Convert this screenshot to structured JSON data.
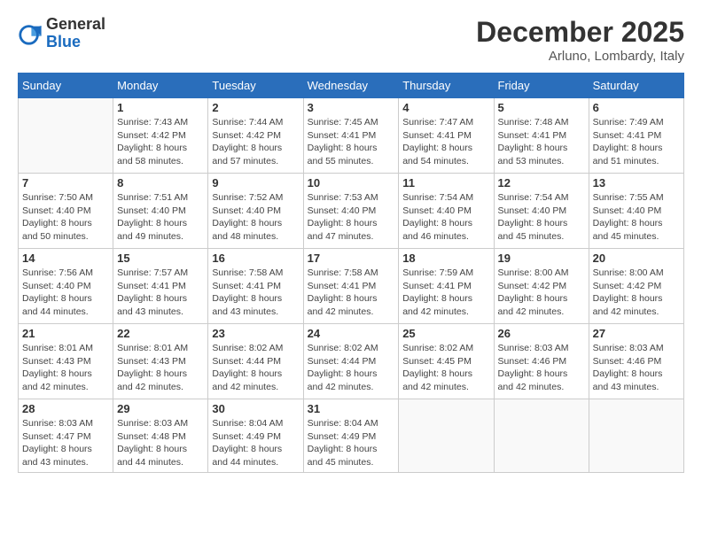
{
  "logo": {
    "general": "General",
    "blue": "Blue"
  },
  "title": "December 2025",
  "location": "Arluno, Lombardy, Italy",
  "days_of_week": [
    "Sunday",
    "Monday",
    "Tuesday",
    "Wednesday",
    "Thursday",
    "Friday",
    "Saturday"
  ],
  "weeks": [
    [
      {
        "day": "",
        "info": ""
      },
      {
        "day": "1",
        "info": "Sunrise: 7:43 AM\nSunset: 4:42 PM\nDaylight: 8 hours\nand 58 minutes."
      },
      {
        "day": "2",
        "info": "Sunrise: 7:44 AM\nSunset: 4:42 PM\nDaylight: 8 hours\nand 57 minutes."
      },
      {
        "day": "3",
        "info": "Sunrise: 7:45 AM\nSunset: 4:41 PM\nDaylight: 8 hours\nand 55 minutes."
      },
      {
        "day": "4",
        "info": "Sunrise: 7:47 AM\nSunset: 4:41 PM\nDaylight: 8 hours\nand 54 minutes."
      },
      {
        "day": "5",
        "info": "Sunrise: 7:48 AM\nSunset: 4:41 PM\nDaylight: 8 hours\nand 53 minutes."
      },
      {
        "day": "6",
        "info": "Sunrise: 7:49 AM\nSunset: 4:41 PM\nDaylight: 8 hours\nand 51 minutes."
      }
    ],
    [
      {
        "day": "7",
        "info": "Sunrise: 7:50 AM\nSunset: 4:40 PM\nDaylight: 8 hours\nand 50 minutes."
      },
      {
        "day": "8",
        "info": "Sunrise: 7:51 AM\nSunset: 4:40 PM\nDaylight: 8 hours\nand 49 minutes."
      },
      {
        "day": "9",
        "info": "Sunrise: 7:52 AM\nSunset: 4:40 PM\nDaylight: 8 hours\nand 48 minutes."
      },
      {
        "day": "10",
        "info": "Sunrise: 7:53 AM\nSunset: 4:40 PM\nDaylight: 8 hours\nand 47 minutes."
      },
      {
        "day": "11",
        "info": "Sunrise: 7:54 AM\nSunset: 4:40 PM\nDaylight: 8 hours\nand 46 minutes."
      },
      {
        "day": "12",
        "info": "Sunrise: 7:54 AM\nSunset: 4:40 PM\nDaylight: 8 hours\nand 45 minutes."
      },
      {
        "day": "13",
        "info": "Sunrise: 7:55 AM\nSunset: 4:40 PM\nDaylight: 8 hours\nand 45 minutes."
      }
    ],
    [
      {
        "day": "14",
        "info": "Sunrise: 7:56 AM\nSunset: 4:40 PM\nDaylight: 8 hours\nand 44 minutes."
      },
      {
        "day": "15",
        "info": "Sunrise: 7:57 AM\nSunset: 4:41 PM\nDaylight: 8 hours\nand 43 minutes."
      },
      {
        "day": "16",
        "info": "Sunrise: 7:58 AM\nSunset: 4:41 PM\nDaylight: 8 hours\nand 43 minutes."
      },
      {
        "day": "17",
        "info": "Sunrise: 7:58 AM\nSunset: 4:41 PM\nDaylight: 8 hours\nand 42 minutes."
      },
      {
        "day": "18",
        "info": "Sunrise: 7:59 AM\nSunset: 4:41 PM\nDaylight: 8 hours\nand 42 minutes."
      },
      {
        "day": "19",
        "info": "Sunrise: 8:00 AM\nSunset: 4:42 PM\nDaylight: 8 hours\nand 42 minutes."
      },
      {
        "day": "20",
        "info": "Sunrise: 8:00 AM\nSunset: 4:42 PM\nDaylight: 8 hours\nand 42 minutes."
      }
    ],
    [
      {
        "day": "21",
        "info": "Sunrise: 8:01 AM\nSunset: 4:43 PM\nDaylight: 8 hours\nand 42 minutes."
      },
      {
        "day": "22",
        "info": "Sunrise: 8:01 AM\nSunset: 4:43 PM\nDaylight: 8 hours\nand 42 minutes."
      },
      {
        "day": "23",
        "info": "Sunrise: 8:02 AM\nSunset: 4:44 PM\nDaylight: 8 hours\nand 42 minutes."
      },
      {
        "day": "24",
        "info": "Sunrise: 8:02 AM\nSunset: 4:44 PM\nDaylight: 8 hours\nand 42 minutes."
      },
      {
        "day": "25",
        "info": "Sunrise: 8:02 AM\nSunset: 4:45 PM\nDaylight: 8 hours\nand 42 minutes."
      },
      {
        "day": "26",
        "info": "Sunrise: 8:03 AM\nSunset: 4:46 PM\nDaylight: 8 hours\nand 42 minutes."
      },
      {
        "day": "27",
        "info": "Sunrise: 8:03 AM\nSunset: 4:46 PM\nDaylight: 8 hours\nand 43 minutes."
      }
    ],
    [
      {
        "day": "28",
        "info": "Sunrise: 8:03 AM\nSunset: 4:47 PM\nDaylight: 8 hours\nand 43 minutes."
      },
      {
        "day": "29",
        "info": "Sunrise: 8:03 AM\nSunset: 4:48 PM\nDaylight: 8 hours\nand 44 minutes."
      },
      {
        "day": "30",
        "info": "Sunrise: 8:04 AM\nSunset: 4:49 PM\nDaylight: 8 hours\nand 44 minutes."
      },
      {
        "day": "31",
        "info": "Sunrise: 8:04 AM\nSunset: 4:49 PM\nDaylight: 8 hours\nand 45 minutes."
      },
      {
        "day": "",
        "info": ""
      },
      {
        "day": "",
        "info": ""
      },
      {
        "day": "",
        "info": ""
      }
    ]
  ]
}
